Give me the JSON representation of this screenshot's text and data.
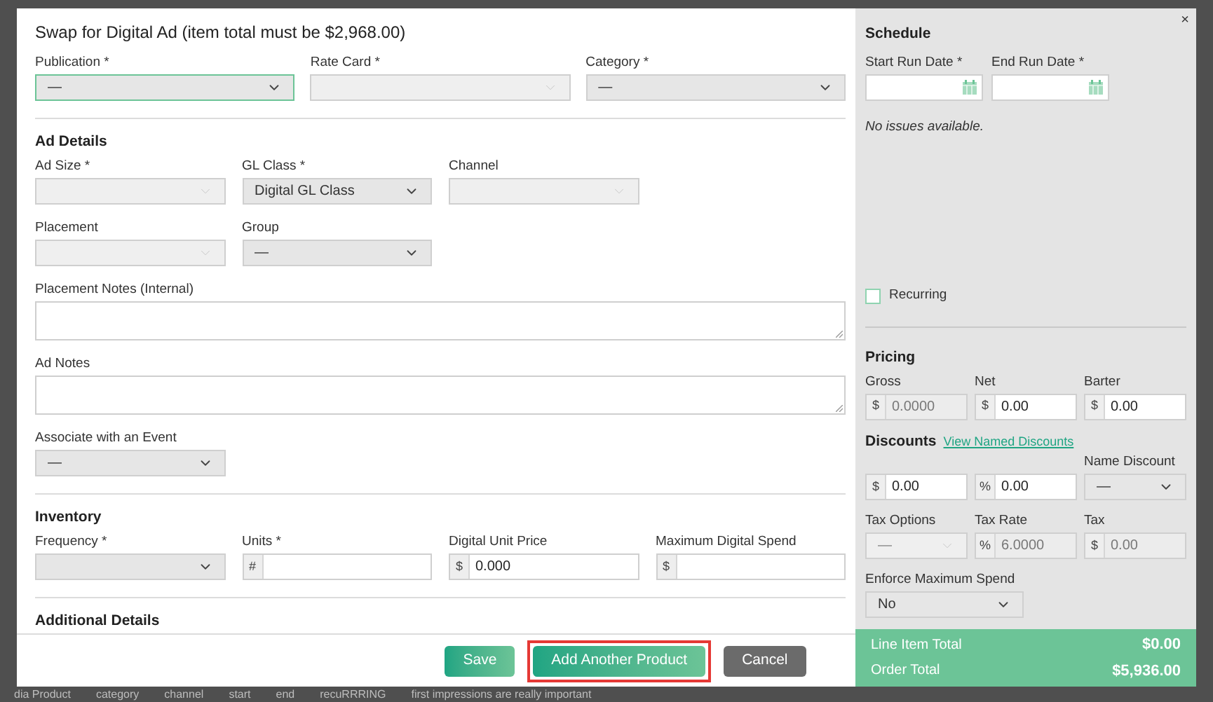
{
  "backdrop": {
    "bottom_fragments": [
      "dia Product",
      "category",
      "channel",
      "start",
      "end",
      "recuRRRING",
      "first impressions are really important"
    ]
  },
  "dialog": {
    "title": "Swap for Digital Ad (item total must be $2,968.00)",
    "close": "×",
    "top_fields": [
      {
        "label": "Publication *",
        "kind": "select",
        "value": "—",
        "disabled": false,
        "focused": true
      },
      {
        "label": "Rate Card *",
        "kind": "select",
        "disabled": true,
        "focused": false
      },
      {
        "label": "Category *",
        "kind": "select",
        "value": "—",
        "disabled": false,
        "focused": false
      }
    ],
    "sections": [
      {
        "heading": "Ad Details",
        "rows": [
          [
            {
              "label": "Ad Size *",
              "kind": "select",
              "disabled": true,
              "focused": false
            },
            {
              "label": "GL Class *",
              "kind": "select",
              "value": "Digital GL Class",
              "disabled": false,
              "focused": false
            },
            {
              "label": "Channel",
              "kind": "select",
              "disabled": true,
              "focused": false
            }
          ],
          [
            {
              "label": "Placement",
              "kind": "select",
              "disabled": true,
              "focused": false
            },
            {
              "label": "Group",
              "kind": "select",
              "value": "—",
              "disabled": false,
              "focused": false
            }
          ],
          [
            {
              "label": "Placement Notes (Internal)",
              "kind": "textarea"
            }
          ],
          [
            {
              "label": "Ad Notes",
              "kind": "textarea"
            }
          ],
          [
            {
              "label": "Associate with an Event",
              "kind": "select",
              "value": "—",
              "disabled": false,
              "focused": false
            }
          ]
        ]
      },
      {
        "heading": "Inventory",
        "rows": [
          [
            {
              "label": "Frequency *",
              "kind": "select",
              "disabled": false,
              "focused": false
            },
            {
              "label": "Units *",
              "kind": "input",
              "prefix": "#",
              "disabled": false
            },
            {
              "label": "Digital Unit Price",
              "kind": "input",
              "prefix": "$",
              "value": "0.000",
              "disabled": false
            },
            {
              "label": "Maximum Digital Spend",
              "kind": "input",
              "prefix": "$",
              "disabled": false
            }
          ]
        ]
      },
      {
        "heading": "Additional Details"
      }
    ],
    "buttons": [
      {
        "label": "Save",
        "kind": "primary",
        "highlighted": false
      },
      {
        "label": "Add Another Product",
        "kind": "primary",
        "highlighted": true
      },
      {
        "label": "Cancel",
        "kind": "secondary",
        "highlighted": false
      }
    ],
    "schedule": {
      "heading": "Schedule",
      "date_fields": [
        {
          "label": "Start Run Date *"
        },
        {
          "label": "End Run Date *"
        }
      ],
      "message": "No issues available.",
      "recurring": {
        "label": "Recurring",
        "checked": false
      }
    },
    "pricing": {
      "heading": "Pricing",
      "fields": [
        {
          "label": "Gross",
          "kind": "input",
          "prefix": "$",
          "value": "0.0000",
          "disabled": true
        },
        {
          "label": "Net",
          "kind": "input",
          "prefix": "$",
          "value": "0.00",
          "disabled": false
        },
        {
          "label": "Barter",
          "kind": "input",
          "prefix": "$",
          "value": "0.00",
          "disabled": false
        }
      ],
      "discounts": {
        "heading": "Discounts",
        "link": "View Named Discounts",
        "fields": [
          {
            "kind": "input",
            "prefix": "$",
            "value": "0.00",
            "disabled": false
          },
          {
            "kind": "input",
            "prefix": "%",
            "value": "0.00",
            "disabled": false
          },
          {
            "label": "Name Discount",
            "kind": "select",
            "value": "—",
            "disabled": false,
            "focused": false
          }
        ]
      },
      "tax_fields": [
        {
          "label": "Tax Options",
          "kind": "select",
          "value": "—",
          "disabled": true,
          "focused": false
        },
        {
          "label": "Tax Rate",
          "kind": "input",
          "prefix": "%",
          "value": "6.0000",
          "disabled": true
        },
        {
          "label": "Tax",
          "kind": "input",
          "prefix": "$",
          "value": "0.00",
          "disabled": true
        }
      ],
      "enforce_field": {
        "label": "Enforce Maximum Spend",
        "kind": "select",
        "value": "No",
        "disabled": false,
        "focused": false
      }
    },
    "totals": [
      {
        "label": "Line Item Total",
        "value": "$0.00"
      },
      {
        "label": "Order Total",
        "value": "$5,936.00"
      }
    ]
  }
}
